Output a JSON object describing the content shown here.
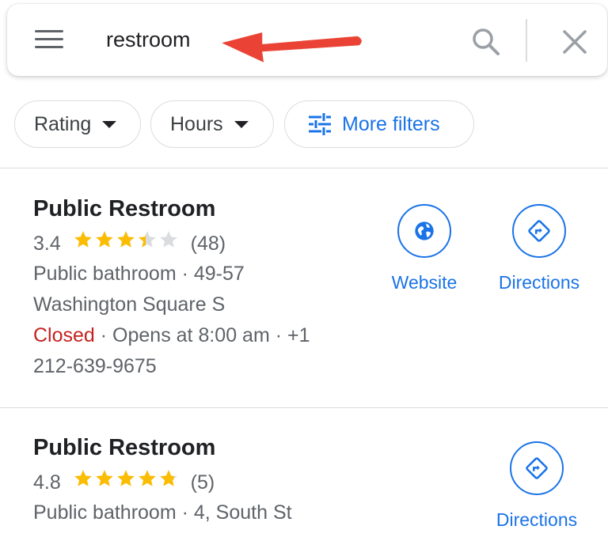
{
  "search": {
    "query": "restroom"
  },
  "filters": {
    "rating_label": "Rating",
    "hours_label": "Hours",
    "more_filters_label": "More filters"
  },
  "results": [
    {
      "name": "Public Restroom",
      "rating": "3.4",
      "rating_value": 3.4,
      "review_count": "(48)",
      "category_address_line1": "Public bathroom · 49-57",
      "address_line2": "Washington Square S",
      "status": "Closed",
      "hours_detail": " · Opens at 8:00 am · +1",
      "phone": "212-639-9675",
      "website_label": "Website",
      "directions_label": "Directions"
    },
    {
      "name": "Public Restroom",
      "rating": "4.8",
      "rating_value": 4.8,
      "review_count": "(5)",
      "category_address_line1": "Public bathroom · 4, South St",
      "directions_label": "Directions"
    }
  ],
  "colors": {
    "accent": "#1a73e8",
    "star": "#fbbc04",
    "star_empty": "#dadce0",
    "closed": "#c5221f",
    "annotation_arrow": "#ea4335"
  },
  "icons": {
    "menu": "hamburger-menu-icon",
    "search": "search-icon",
    "close": "close-icon",
    "filters": "tune-filters-icon",
    "website": "globe-icon",
    "directions": "directions-icon",
    "annotation": "red-arrow-annotation"
  }
}
